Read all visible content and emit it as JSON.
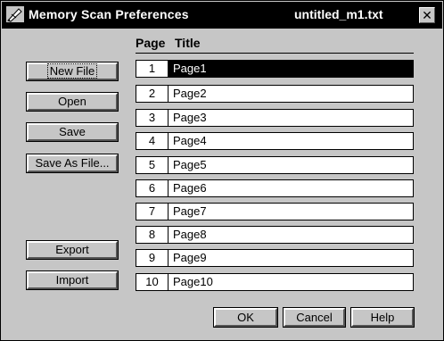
{
  "window": {
    "title": "Memory Scan Preferences",
    "filename": "untitled_m1.txt",
    "close_icon": "close-icon",
    "app_icon": "pen-icon"
  },
  "columns": {
    "page": "Page",
    "title": "Title"
  },
  "side_buttons": {
    "new_file": "New File",
    "open": "Open",
    "save": "Save",
    "save_as": "Save As File...",
    "export": "Export",
    "import": "Import"
  },
  "pages": [
    {
      "num": "1",
      "title": "Page1"
    },
    {
      "num": "2",
      "title": "Page2"
    },
    {
      "num": "3",
      "title": "Page3"
    },
    {
      "num": "4",
      "title": "Page4"
    },
    {
      "num": "5",
      "title": "Page5"
    },
    {
      "num": "6",
      "title": "Page6"
    },
    {
      "num": "7",
      "title": "Page7"
    },
    {
      "num": "8",
      "title": "Page8"
    },
    {
      "num": "9",
      "title": "Page9"
    },
    {
      "num": "10",
      "title": "Page10"
    }
  ],
  "dialog_buttons": {
    "ok": "OK",
    "cancel": "Cancel",
    "help": "Help"
  },
  "colors": {
    "face": "#c6c6c6",
    "titlebar": "#000000",
    "selection": "#000000"
  }
}
